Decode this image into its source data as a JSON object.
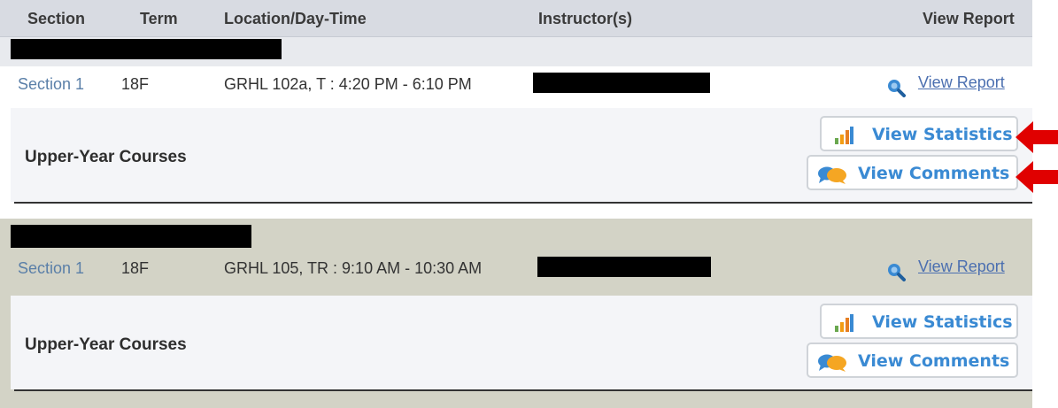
{
  "header": {
    "section": "Section",
    "term": "Term",
    "location": "Location/Day-Time",
    "instructors": "Instructor(s)",
    "view_report": "View Report"
  },
  "courses": [
    {
      "section": "Section 1",
      "term": "18F",
      "location": "GRHL 102a, T : 4:20 PM - 6:10 PM",
      "view_report": "View Report",
      "category": "Upper-Year Courses",
      "stats_label": "View Statistics",
      "comments_label": "View Comments"
    },
    {
      "section": "Section 1",
      "term": "18F",
      "location": "GRHL 105, TR : 9:10 AM - 10:30 AM",
      "view_report": "View Report",
      "category": "Upper-Year Courses",
      "stats_label": "View Statistics",
      "comments_label": "View Comments"
    }
  ],
  "colors": {
    "link": "#4b6fb0",
    "button_text": "#3a8ad3",
    "arrow": "#e00000",
    "group_highlight": "#d3d3c6"
  },
  "icons": [
    "search-icon",
    "bar-chart-icon",
    "speech-bubbles-icon",
    "red-arrow-icon"
  ]
}
